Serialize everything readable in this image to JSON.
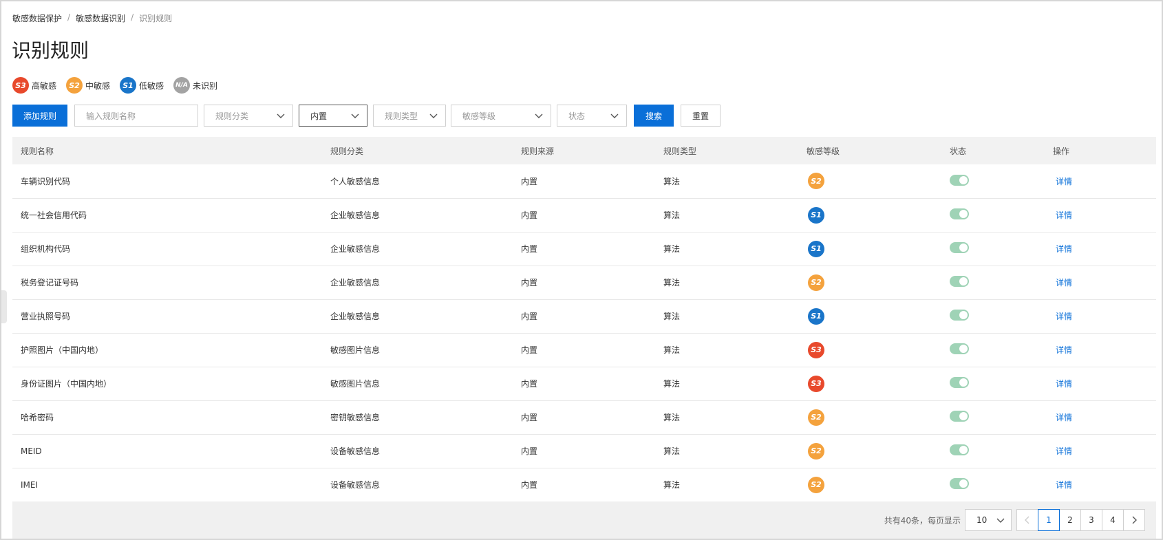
{
  "breadcrumb": [
    "敏感数据保护",
    "敏感数据识别",
    "识别规则"
  ],
  "page_title": "识别规则",
  "legend": [
    {
      "code": "S3",
      "label": "高敏感",
      "color": "#e8492c"
    },
    {
      "code": "S2",
      "label": "中敏感",
      "color": "#f4a23d"
    },
    {
      "code": "S1",
      "label": "低敏感",
      "color": "#1a75c9"
    },
    {
      "code": "N/A",
      "label": "未识别",
      "color": "#a3a3a3"
    }
  ],
  "toolbar": {
    "add_label": "添加规则",
    "search_placeholder": "输入规则名称",
    "category_select": "规则分类",
    "source_select": "内置",
    "type_select": "规则类型",
    "level_select": "敏感等级",
    "status_select": "状态",
    "search_label": "搜索",
    "reset_label": "重置"
  },
  "table": {
    "columns": [
      "规则名称",
      "规则分类",
      "规则来源",
      "规则类型",
      "敏感等级",
      "状态",
      "操作"
    ],
    "detail_label": "详情",
    "rows": [
      {
        "name": "车辆识别代码",
        "category": "个人敏感信息",
        "source": "内置",
        "type": "算法",
        "level": "S2",
        "enabled": true
      },
      {
        "name": "统一社会信用代码",
        "category": "企业敏感信息",
        "source": "内置",
        "type": "算法",
        "level": "S1",
        "enabled": true
      },
      {
        "name": "组织机构代码",
        "category": "企业敏感信息",
        "source": "内置",
        "type": "算法",
        "level": "S1",
        "enabled": true
      },
      {
        "name": "税务登记证号码",
        "category": "企业敏感信息",
        "source": "内置",
        "type": "算法",
        "level": "S2",
        "enabled": true
      },
      {
        "name": "营业执照号码",
        "category": "企业敏感信息",
        "source": "内置",
        "type": "算法",
        "level": "S1",
        "enabled": true
      },
      {
        "name": "护照图片（中国内地）",
        "category": "敏感图片信息",
        "source": "内置",
        "type": "算法",
        "level": "S3",
        "enabled": true
      },
      {
        "name": "身份证图片（中国内地）",
        "category": "敏感图片信息",
        "source": "内置",
        "type": "算法",
        "level": "S3",
        "enabled": true
      },
      {
        "name": "哈希密码",
        "category": "密钥敏感信息",
        "source": "内置",
        "type": "算法",
        "level": "S2",
        "enabled": true
      },
      {
        "name": "MEID",
        "category": "设备敏感信息",
        "source": "内置",
        "type": "算法",
        "level": "S2",
        "enabled": true
      },
      {
        "name": "IMEI",
        "category": "设备敏感信息",
        "source": "内置",
        "type": "算法",
        "level": "S2",
        "enabled": true
      }
    ]
  },
  "pagination": {
    "total_text": "共有40条，每页显示",
    "page_size": "10",
    "pages": [
      "1",
      "2",
      "3",
      "4"
    ],
    "current": "1"
  }
}
